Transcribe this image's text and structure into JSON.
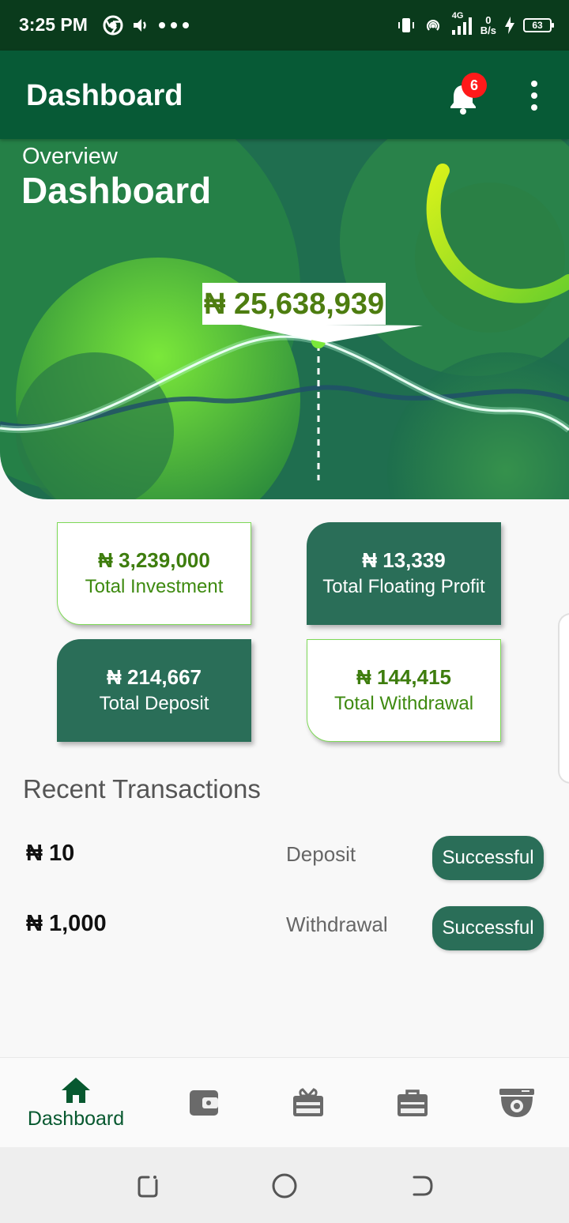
{
  "status_bar": {
    "time": "3:25 PM",
    "left_icons": [
      "chrome-icon",
      "volume-icon",
      "more-dots-icon"
    ],
    "right_icons": [
      "vibrate-icon",
      "hotspot-icon",
      "signal-4g-icon",
      "charging-icon"
    ],
    "network_label": "4G",
    "net_speed_value": "0",
    "net_speed_unit": "B/s",
    "battery": "63"
  },
  "app_bar": {
    "title": "Dashboard",
    "notification_count": "6"
  },
  "hero": {
    "overline": "Overview",
    "headline": "Dashboard",
    "total": "₦ 25,638,939"
  },
  "cards": [
    {
      "amount": "₦ 3,239,000",
      "label": "Total Investment",
      "style": "light"
    },
    {
      "amount": "₦ 13,339",
      "label": "Total Floating Profit",
      "style": "dark"
    },
    {
      "amount": "₦ 214,667",
      "label": "Total Deposit",
      "style": "dark"
    },
    {
      "amount": "₦ 144,415",
      "label": "Total Withdrawal",
      "style": "light"
    }
  ],
  "recent": {
    "title": "Recent Transactions",
    "rows": [
      {
        "amount": "₦ 10",
        "type": "Deposit",
        "status": "Successful"
      },
      {
        "amount": "₦ 1,000",
        "type": "Withdrawal",
        "status": "Successful"
      }
    ]
  },
  "bottom_nav": {
    "items": [
      {
        "icon": "home-icon",
        "label": "Dashboard",
        "active": true
      },
      {
        "icon": "wallet-icon",
        "label": "",
        "active": false
      },
      {
        "icon": "gift-icon",
        "label": "",
        "active": false
      },
      {
        "icon": "briefcase-icon",
        "label": "",
        "active": false
      },
      {
        "icon": "camera-icon",
        "label": "",
        "active": false
      }
    ]
  },
  "colors": {
    "status_bar": "#0a3b1c",
    "app_bar": "#075a36",
    "card_dark": "#2a6e58",
    "accent_green": "#4d7d10",
    "badge": "#ff1a1a"
  }
}
